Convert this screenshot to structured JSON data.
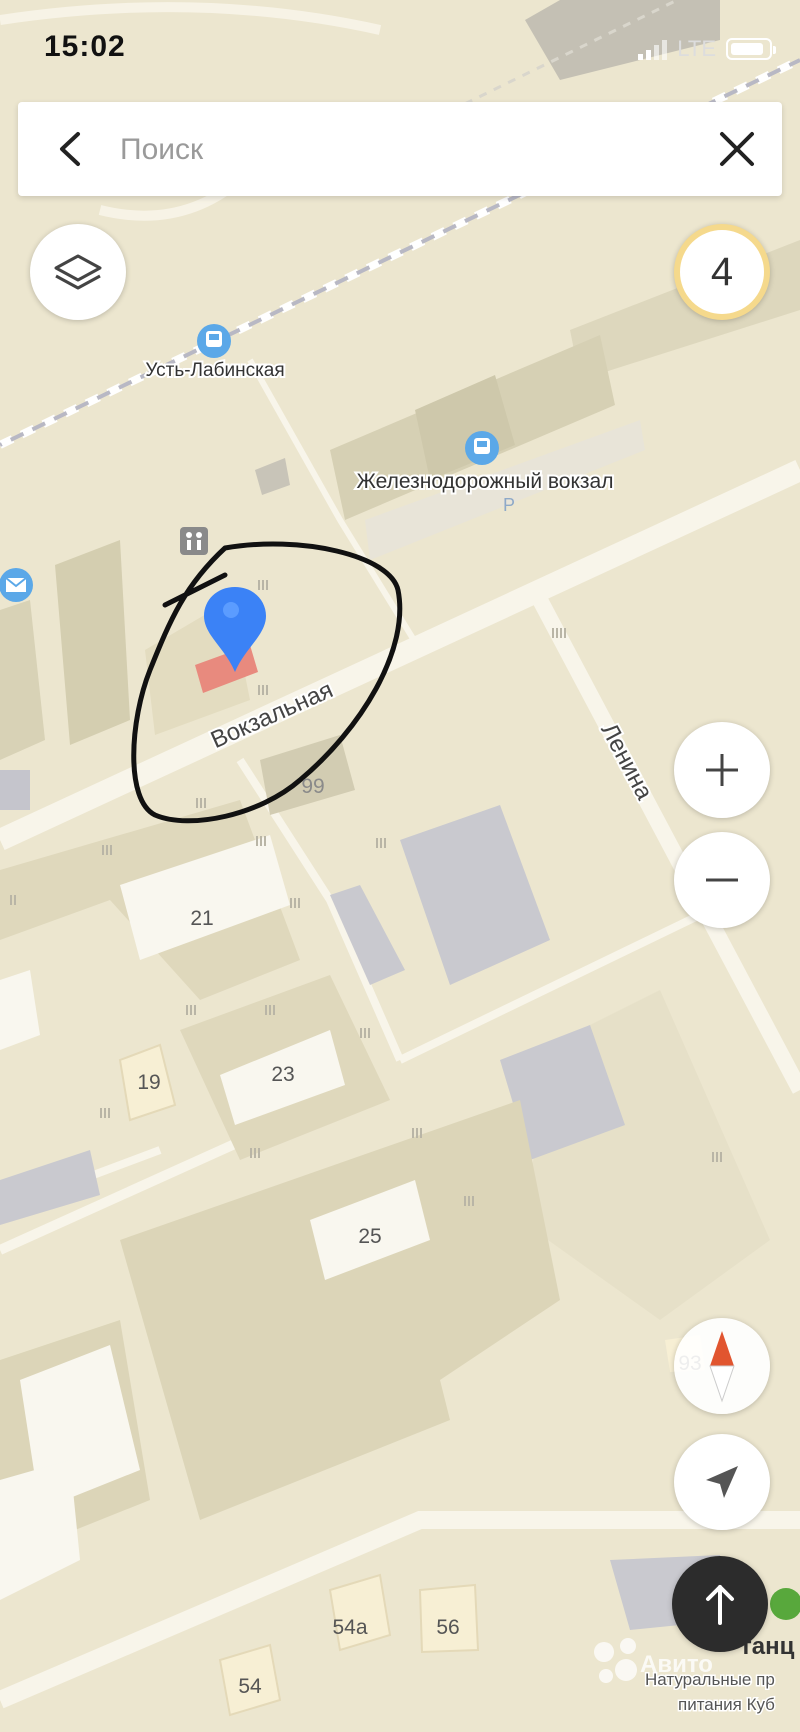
{
  "status_bar": {
    "time": "15:02",
    "network": "LTE"
  },
  "search": {
    "placeholder": "Поиск",
    "value": ""
  },
  "map": {
    "street_labels": [
      "Вокзальная",
      "Ленина"
    ],
    "poi_labels": [
      "Усть-Лабинская",
      "Железнодорожный вокзал",
      "Натуральные пр",
      "питания Куб",
      "Авито",
      "Р",
      "танц"
    ],
    "house_numbers": [
      "99",
      "21",
      "19",
      "23",
      "25",
      "93",
      "54а",
      "56",
      "54"
    ],
    "pin_color": "#3b82f6"
  },
  "controls": {
    "traffic_level": "4",
    "zoom_in": "+",
    "zoom_out": "−",
    "icons": [
      "back-arrow-icon",
      "close-icon",
      "layers-icon",
      "plus-icon",
      "minus-icon",
      "compass-icon",
      "location-arrow-icon",
      "route-up-arrow-icon"
    ]
  }
}
